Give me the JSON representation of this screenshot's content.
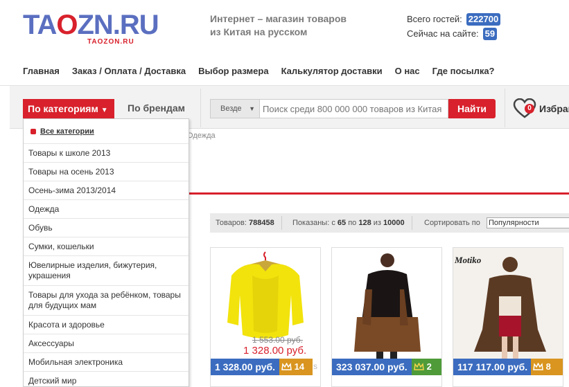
{
  "header": {
    "logo_text": "TAOZN.RU",
    "logo_text_left": "TA",
    "logo_text_globe": "O",
    "logo_text_right": "ZN.RU",
    "logo_sub": "TAOZON.RU",
    "tagline_line1": "Интернет – магазин товаров",
    "tagline_line2": "из Китая на русском",
    "guests_label": "Всего гостей:",
    "guests_value": "222700",
    "online_label": "Сейчас на сайте:",
    "online_value": "59"
  },
  "nav": [
    "Главная",
    "Заказ / Оплата / Доставка",
    "Выбор размера",
    "Калькулятор доставки",
    "О нас",
    "Где посылка?"
  ],
  "searchbar": {
    "categories_button": "По категориям",
    "categories_caret": "▼",
    "brands_button": "По брендам",
    "scope_value": "Везде",
    "scope_caret": "▼",
    "placeholder": "Поиск среди 800 000 000 товаров из Китая",
    "find_button": "Найти",
    "favorites_count": "0",
    "favorites_label": "Избранное"
  },
  "breadcrumb": "Одежда",
  "dropdown": {
    "all_label": "Все категории",
    "items": [
      "Товары к школе 2013",
      "Товары на осень 2013",
      "Осень-зима 2013/2014",
      "Одежда",
      "Обувь",
      "Сумки, кошельки",
      "Ювелирные изделия, бижутерия, украшения",
      "Товары для ухода за ребёнком, товары для будущих мам",
      "Красота и здоровье",
      "Аксессуары",
      "Мобильная электроника",
      "Детский мир"
    ]
  },
  "toolbar": {
    "total_label": "Товаров:",
    "total_value": "788458",
    "shown_label": "Показаны: с",
    "shown_from": "65",
    "shown_to_label": "по",
    "shown_to": "128",
    "shown_of_label": "из",
    "shown_of": "10000",
    "sort_label": "Сортировать по",
    "sort_value": "Популярности"
  },
  "products": [
    {
      "price": "1 328.00 руб.",
      "old_price": "1 553.00 руб.",
      "new_price": "1 328.00 руб.",
      "rating": "14",
      "tier": "gold",
      "suffix": "s"
    },
    {
      "price": "323 037.00 руб.",
      "rating": "2",
      "tier": "green"
    },
    {
      "price": "117 117.00 руб.",
      "rating": "8",
      "tier": "gold",
      "brand": "Motiko"
    }
  ],
  "colors": {
    "accent": "#d8212c",
    "price_bg": "#3b6cbf",
    "crown_green": "#4f9b3a",
    "crown_gold": "#d99520"
  }
}
